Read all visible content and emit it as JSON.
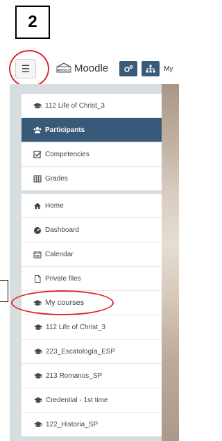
{
  "annotation": {
    "step_number": "2"
  },
  "header": {
    "brand": "Moodle",
    "logo_text": "MOODLE",
    "cut_text": "My"
  },
  "drawer": {
    "course_section": [
      {
        "label": "112 Life of Christ_3",
        "icon": "graduation-cap-icon",
        "active": false
      },
      {
        "label": "Participants",
        "icon": "users-icon",
        "active": true
      },
      {
        "label": "Competencies",
        "icon": "checkbox-icon",
        "active": false
      },
      {
        "label": "Grades",
        "icon": "table-icon",
        "active": false
      }
    ],
    "site_section": [
      {
        "label": "Home",
        "icon": "home-icon"
      },
      {
        "label": "Dashboard",
        "icon": "dashboard-icon"
      },
      {
        "label": "Calendar",
        "icon": "calendar-icon"
      },
      {
        "label": "Private files",
        "icon": "file-icon"
      },
      {
        "label": "My courses",
        "icon": "graduation-cap-icon"
      }
    ],
    "courses": [
      {
        "label": "112 Life of Christ_3",
        "icon": "graduation-cap-icon"
      },
      {
        "label": "223_Escatología_ESP",
        "icon": "graduation-cap-icon"
      },
      {
        "label": "213 Romanos_SP",
        "icon": "graduation-cap-icon"
      },
      {
        "label": "Credential - 1st time",
        "icon": "graduation-cap-icon"
      },
      {
        "label": "122_Historia_SP",
        "icon": "graduation-cap-icon"
      }
    ]
  },
  "colors": {
    "accent": "#375a79",
    "highlight_ring": "#e0282b"
  }
}
